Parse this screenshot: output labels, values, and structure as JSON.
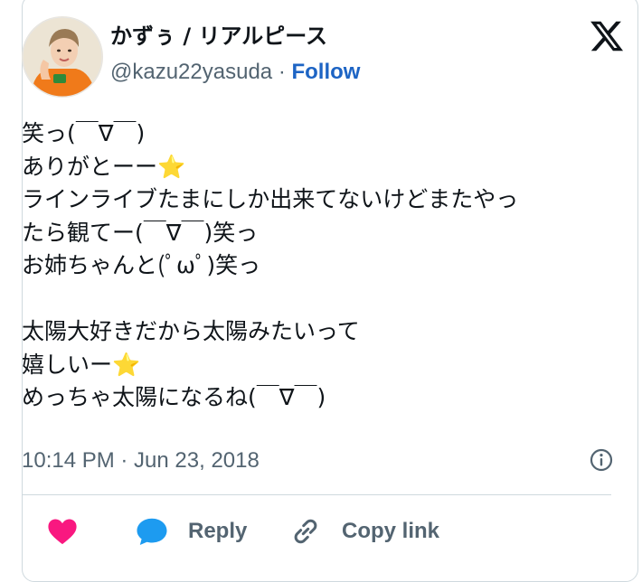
{
  "user": {
    "display_name": "かずぅ / リアルピース",
    "handle": "@kazu22yasuda",
    "separator": " · ",
    "follow_label": "Follow"
  },
  "tweet": {
    "lines": [
      "笑っ(￣∇￣)",
      "ありがとーー⭐️",
      "ラインライブたまにしか出来てないけどまたやっ",
      "たら観てー(￣∇￣)笑っ",
      "お姉ちゃんと(ﾟωﾟ)笑っ",
      "",
      "太陽大好きだから太陽みたいって",
      "嬉しいー⭐️",
      "めっちゃ太陽になるね(￣∇￣)"
    ],
    "timestamp": "10:14 PM · Jun 23, 2018"
  },
  "actions": {
    "like_icon": "heart-icon",
    "reply_label": "Reply",
    "copy_link_label": "Copy link"
  },
  "colors": {
    "link": "#1d64c4",
    "like": "#f91880",
    "reply_bubble": "#1d9bf0",
    "muted": "#536471"
  }
}
